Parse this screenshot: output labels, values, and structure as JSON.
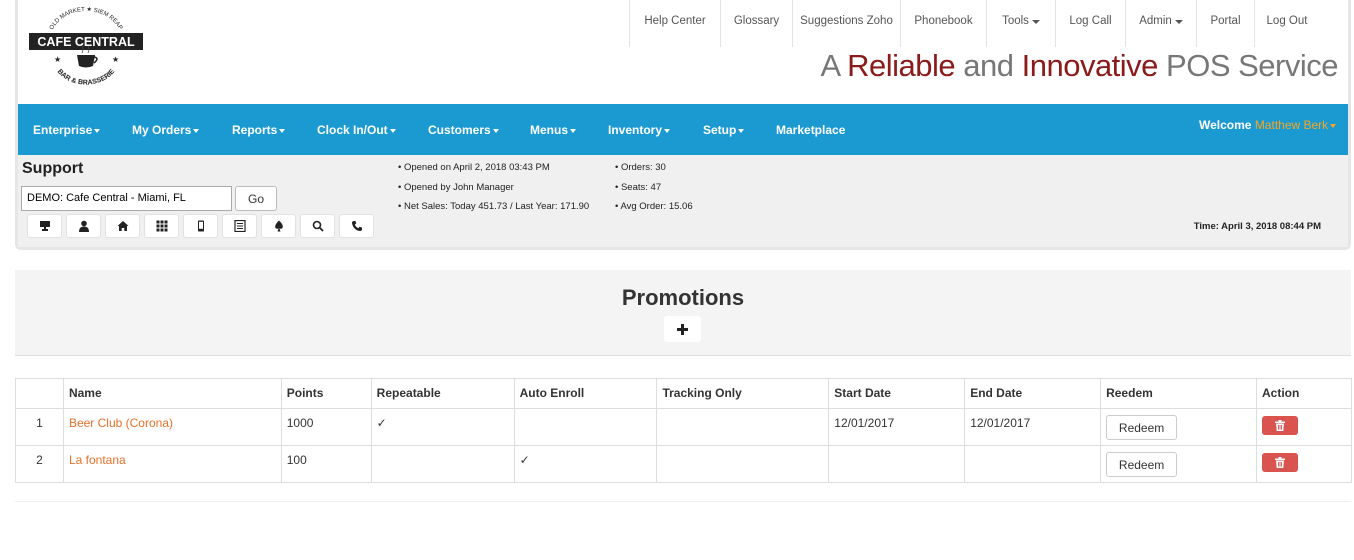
{
  "logo": {
    "arc_text": "OLD MARKET ★ SIEM REAP",
    "name": "CAFE CENTRAL",
    "sub": "BAR & BRASSERIE"
  },
  "topnav": [
    {
      "label": "Help Center",
      "dropdown": false
    },
    {
      "label": "Glossary",
      "dropdown": false
    },
    {
      "label": "Suggestions Zoho",
      "dropdown": false
    },
    {
      "label": "Phonebook",
      "dropdown": false
    },
    {
      "label": "Tools",
      "dropdown": true
    },
    {
      "label": "Log Call",
      "dropdown": false
    },
    {
      "label": "Admin",
      "dropdown": true
    },
    {
      "label": "Portal",
      "dropdown": false
    },
    {
      "label": "Log Out",
      "dropdown": false
    }
  ],
  "tagline": {
    "p1": "A ",
    "p2": "Reliable",
    "p3": " and ",
    "p4": "Innovative",
    "p5": " POS Service"
  },
  "mainnav": [
    {
      "label": "Enterprise",
      "dropdown": true
    },
    {
      "label": "My Orders",
      "dropdown": true
    },
    {
      "label": "Reports",
      "dropdown": true
    },
    {
      "label": "Clock In/Out",
      "dropdown": true
    },
    {
      "label": "Customers",
      "dropdown": true
    },
    {
      "label": "Menus",
      "dropdown": true
    },
    {
      "label": "Inventory",
      "dropdown": true
    },
    {
      "label": "Setup",
      "dropdown": true
    },
    {
      "label": "Marketplace",
      "dropdown": false
    }
  ],
  "welcome": {
    "label": "Welcome",
    "user": "Matthew Berk"
  },
  "support": {
    "title": "Support",
    "store": "DEMO: Cafe Central - Miami, FL",
    "go": "Go",
    "icons": [
      "pos-terminal-icon",
      "user-icon",
      "home-icon",
      "grid-icon",
      "mobile-icon",
      "list-icon",
      "spade-icon",
      "search-icon",
      "phone-icon"
    ],
    "info_left": [
      "• Opened on April 2, 2018 03:43 PM",
      "• Opened by John Manager",
      "• Net Sales: Today 451.73 / Last Year: 171.90"
    ],
    "info_right": [
      "• Orders: 30",
      "• Seats: 47",
      "• Avg Order: 15.06"
    ],
    "time": "Time: April 3, 2018 08:44 PM"
  },
  "promotions": {
    "title": "Promotions",
    "columns": [
      "",
      "Name",
      "Points",
      "Repeatable",
      "Auto Enroll",
      "Tracking Only",
      "Start Date",
      "End Date",
      "Reedem",
      "Action"
    ],
    "rows": [
      {
        "num": "1",
        "name": "Beer Club (Corona)",
        "points": "1000",
        "repeatable": "✓",
        "auto_enroll": "",
        "tracking_only": "",
        "start": "12/01/2017",
        "end": "12/01/2017",
        "redeem": "Redeem"
      },
      {
        "num": "2",
        "name": "La fontana",
        "points": "100",
        "repeatable": "",
        "auto_enroll": "✓",
        "tracking_only": "",
        "start": "",
        "end": "",
        "redeem": "Redeem"
      }
    ]
  }
}
